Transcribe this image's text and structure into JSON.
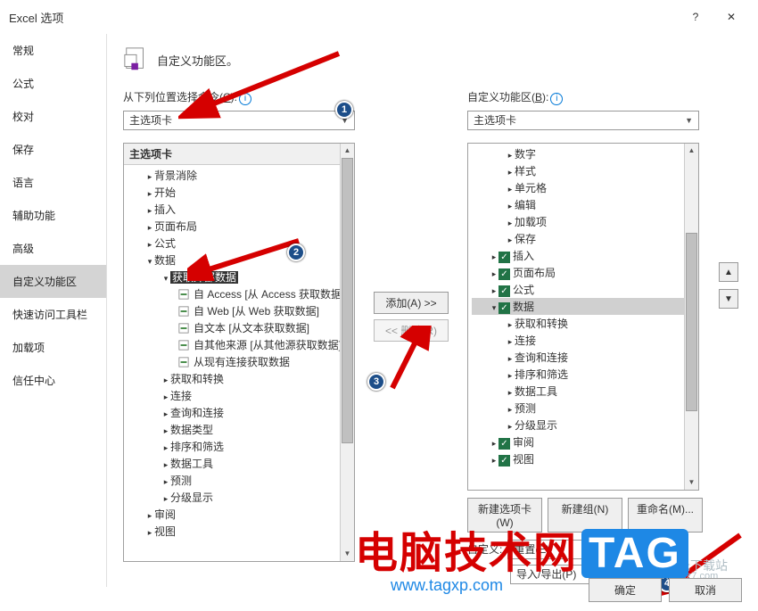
{
  "window": {
    "title": "Excel 选项"
  },
  "sidebar": {
    "items": [
      {
        "label": "常规"
      },
      {
        "label": "公式"
      },
      {
        "label": "校对"
      },
      {
        "label": "保存"
      },
      {
        "label": "语言"
      },
      {
        "label": "辅助功能"
      },
      {
        "label": "高级"
      },
      {
        "label": "自定义功能区"
      },
      {
        "label": "快速访问工具栏"
      },
      {
        "label": "加载项"
      },
      {
        "label": "信任中心"
      }
    ],
    "active_index": 7
  },
  "header": {
    "text": "自定义功能区。"
  },
  "left_panel": {
    "label_prefix": "从下列位置选择命令(",
    "label_key": "C",
    "label_suffix": "):",
    "dropdown": "主选项卡",
    "tree_header": "主选项卡",
    "items": [
      {
        "lvl": 1,
        "caret": ">",
        "label": "背景消除"
      },
      {
        "lvl": 1,
        "caret": ">",
        "label": "开始"
      },
      {
        "lvl": 1,
        "caret": ">",
        "label": "插入"
      },
      {
        "lvl": 1,
        "caret": ">",
        "label": "页面布局"
      },
      {
        "lvl": 1,
        "caret": ">",
        "label": "公式"
      },
      {
        "lvl": 1,
        "caret": "v",
        "label": "数据",
        "badge": 2
      },
      {
        "lvl": 2,
        "caret": "v",
        "label": "获取外部数据",
        "selected": true
      },
      {
        "lvl": 3,
        "icon": "access",
        "label": "自 Access [从 Access 获取数据]"
      },
      {
        "lvl": 3,
        "icon": "web",
        "label": "自 Web [从 Web 获取数据]"
      },
      {
        "lvl": 3,
        "icon": "text",
        "label": "自文本 [从文本获取数据]"
      },
      {
        "lvl": 3,
        "icon": "other",
        "label": "自其他来源 [从其他源获取数据]"
      },
      {
        "lvl": 3,
        "icon": "conn",
        "label": "从现有连接获取数据"
      },
      {
        "lvl": 2,
        "caret": ">",
        "label": "获取和转换"
      },
      {
        "lvl": 2,
        "caret": ">",
        "label": "连接"
      },
      {
        "lvl": 2,
        "caret": ">",
        "label": "查询和连接"
      },
      {
        "lvl": 2,
        "caret": ">",
        "label": "数据类型"
      },
      {
        "lvl": 2,
        "caret": ">",
        "label": "排序和筛选"
      },
      {
        "lvl": 2,
        "caret": ">",
        "label": "数据工具"
      },
      {
        "lvl": 2,
        "caret": ">",
        "label": "预测"
      },
      {
        "lvl": 2,
        "caret": ">",
        "label": "分级显示"
      },
      {
        "lvl": 1,
        "caret": ">",
        "label": "审阅"
      },
      {
        "lvl": 1,
        "caret": ">",
        "label": "视图"
      }
    ]
  },
  "middle": {
    "add_text": "添加(A) >>",
    "remove_text": "<< 删除(R)"
  },
  "right_panel": {
    "label_prefix": "自定义功能区(",
    "label_key": "B",
    "label_suffix": "):",
    "dropdown": "主选项卡",
    "items": [
      {
        "lvl": 2,
        "caret": ">",
        "label": "数字"
      },
      {
        "lvl": 2,
        "caret": ">",
        "label": "样式"
      },
      {
        "lvl": 2,
        "caret": ">",
        "label": "单元格"
      },
      {
        "lvl": 2,
        "caret": ">",
        "label": "编辑"
      },
      {
        "lvl": 2,
        "caret": ">",
        "label": "加载项"
      },
      {
        "lvl": 2,
        "caret": ">",
        "label": "保存"
      },
      {
        "lvl": 1,
        "caret": ">",
        "check": true,
        "label": "插入"
      },
      {
        "lvl": 1,
        "caret": ">",
        "check": true,
        "label": "页面布局"
      },
      {
        "lvl": 1,
        "caret": ">",
        "check": true,
        "label": "公式"
      },
      {
        "lvl": 1,
        "caret": "v",
        "check": true,
        "label": "数据",
        "sel": true
      },
      {
        "lvl": 2,
        "caret": ">",
        "label": "获取和转换"
      },
      {
        "lvl": 2,
        "caret": ">",
        "label": "连接"
      },
      {
        "lvl": 2,
        "caret": ">",
        "label": "查询和连接"
      },
      {
        "lvl": 2,
        "caret": ">",
        "label": "排序和筛选"
      },
      {
        "lvl": 2,
        "caret": ">",
        "label": "数据工具"
      },
      {
        "lvl": 2,
        "caret": ">",
        "label": "预测"
      },
      {
        "lvl": 2,
        "caret": ">",
        "label": "分级显示"
      },
      {
        "lvl": 1,
        "caret": ">",
        "check": true,
        "label": "审阅"
      },
      {
        "lvl": 1,
        "caret": ">",
        "check": true,
        "label": "视图"
      }
    ],
    "btns": {
      "new_tab": "新建选项卡(W)",
      "new_group": "新建组(N)",
      "rename": "重命名(M)..."
    },
    "custom_prefix": "自定义:",
    "reset": "重置(E)",
    "import_prefix": "导入/导出(P)"
  },
  "footer": {
    "ok": "确定",
    "cancel": "取消"
  },
  "watermark": {
    "brand": "电脑技术网",
    "tag": "TAG",
    "url": "www.tagxp.com",
    "xlight": "极光下载站",
    "xlight_url": "www.xz7.com"
  }
}
